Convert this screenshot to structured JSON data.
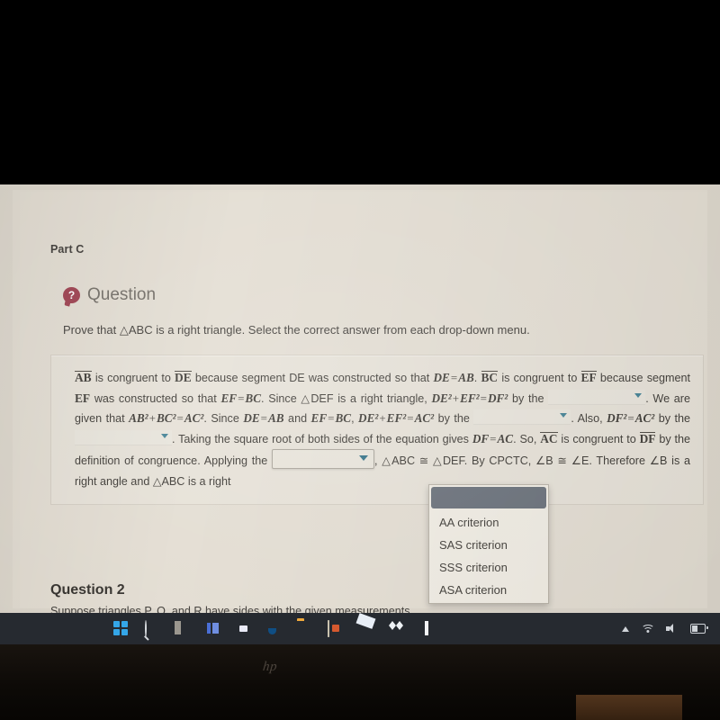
{
  "screen": {
    "part_label": "Part C",
    "question_header": {
      "icon": "question-bubble-icon",
      "title": "Question"
    },
    "prompt": "Prove that △ABC is a right triangle. Select the correct answer from each drop-down menu.",
    "proof": {
      "seg_ab": "AB",
      "t1": " is congruent to ",
      "seg_de": "DE",
      "t2": " because segment DE was constructed so that ",
      "m_de": "DE",
      "eq1": "=",
      "m_ab": "AB",
      "t3": ". ",
      "seg_bc": "BC",
      "t4": " is congruent to ",
      "seg_ef": "EF",
      "t5": " because segment ",
      "m_ef2": "EF",
      "t6": " was constructed so that ",
      "m_ef": "EF",
      "eq2": "=",
      "m_bc": "BC",
      "t7": ". Since △DEF is a right triangle, ",
      "m_de2": "DE²",
      "plus1": "+",
      "m_ef3": "EF²",
      "eq3": "=",
      "m_df2": "DF²",
      "t8": " by the ",
      "t9": ". We are given that ",
      "m_ab2": "AB²",
      "plus2": "+",
      "m_bc2": "BC²",
      "eq4": "=",
      "m_ac2": "AC²",
      "t10": ". Since ",
      "m_de3": "DE",
      "eq5": "=",
      "m_ab3": "AB",
      "t11": " and ",
      "m_ef4": "EF",
      "eq6": "=",
      "m_bc3": "BC",
      "t12": ", ",
      "m_de4": "DE²",
      "plus3": "+",
      "m_ef5": "EF²",
      "eq7": "=",
      "m_ac3": "AC²",
      "t13": " by the ",
      "t14": ". Also, ",
      "m_df3": "DF²",
      "eq8": "=",
      "m_ac4": "AC²",
      "t15": " by the ",
      "t16": ". Taking the square root of both sides of the equation gives ",
      "m_df4": "DF",
      "eq9": "=",
      "m_ac5": "AC",
      "t17": ". So, ",
      "seg_ac": "AC",
      "t18": " is congruent to ",
      "seg_df": "DF",
      "t19": " by the definition of congruence. Applying the ",
      "t20": ", △ABC ≅ △DEF. By CPCTC, ∠B ≅ ∠E. Therefore ∠B is a right angle and △ABC is a right"
    },
    "dropdowns": {
      "blank1": {
        "name": "dropdown-blank-1",
        "value": "",
        "caret": "chevron-down-icon"
      },
      "blank2": {
        "name": "dropdown-blank-2",
        "value": "",
        "caret": "chevron-down-icon"
      },
      "blank3": {
        "name": "dropdown-blank-3",
        "value": "",
        "caret": "chevron-down-icon"
      },
      "blank4": {
        "name": "dropdown-criterion-open",
        "value": "",
        "caret": "chevron-down-icon"
      }
    },
    "open_menu": {
      "name": "criterion-dropdown-menu",
      "options": [
        {
          "label": "",
          "selected": true
        },
        {
          "label": "AA criterion",
          "selected": false
        },
        {
          "label": "SAS criterion",
          "selected": false
        },
        {
          "label": "SSS criterion",
          "selected": false
        },
        {
          "label": "ASA criterion",
          "selected": false
        }
      ]
    },
    "question2": {
      "title": "Question 2",
      "subtitle": "Suppose triangles P, Q, and R have sides with the given measurements."
    }
  },
  "taskbar": {
    "items": [
      {
        "name": "start-button-icon",
        "label": "Start"
      },
      {
        "name": "search-icon",
        "label": "Search"
      },
      {
        "name": "widgets-icon",
        "label": "Widgets"
      },
      {
        "name": "task-view-icon",
        "label": "Task View"
      },
      {
        "name": "teams-chat-icon",
        "label": "Chat"
      },
      {
        "name": "microsoft-edge-icon",
        "label": "Microsoft Edge"
      },
      {
        "name": "file-explorer-icon",
        "label": "File Explorer"
      },
      {
        "name": "microsoft-store-icon",
        "label": "Microsoft Store"
      },
      {
        "name": "mail-icon",
        "label": "Mail"
      },
      {
        "name": "dropbox-icon",
        "label": "Dropbox"
      },
      {
        "name": "office-icon",
        "label": "Office"
      }
    ],
    "tray": [
      {
        "name": "show-hidden-icons-chevron-icon",
        "label": "Show hidden icons"
      },
      {
        "name": "wifi-icon",
        "label": "Network"
      },
      {
        "name": "volume-icon",
        "label": "Volume"
      },
      {
        "name": "battery-icon",
        "label": "Battery"
      }
    ]
  },
  "device": {
    "brand_logo": "hp"
  },
  "colors": {
    "page_bg": "#e3ddd2",
    "card_bg": "#e6e1d7",
    "accent_red": "#9c3c4c",
    "caret_teal": "#2f6f86",
    "menu_selected": "#676e78",
    "taskbar_bg": "#262a30"
  }
}
